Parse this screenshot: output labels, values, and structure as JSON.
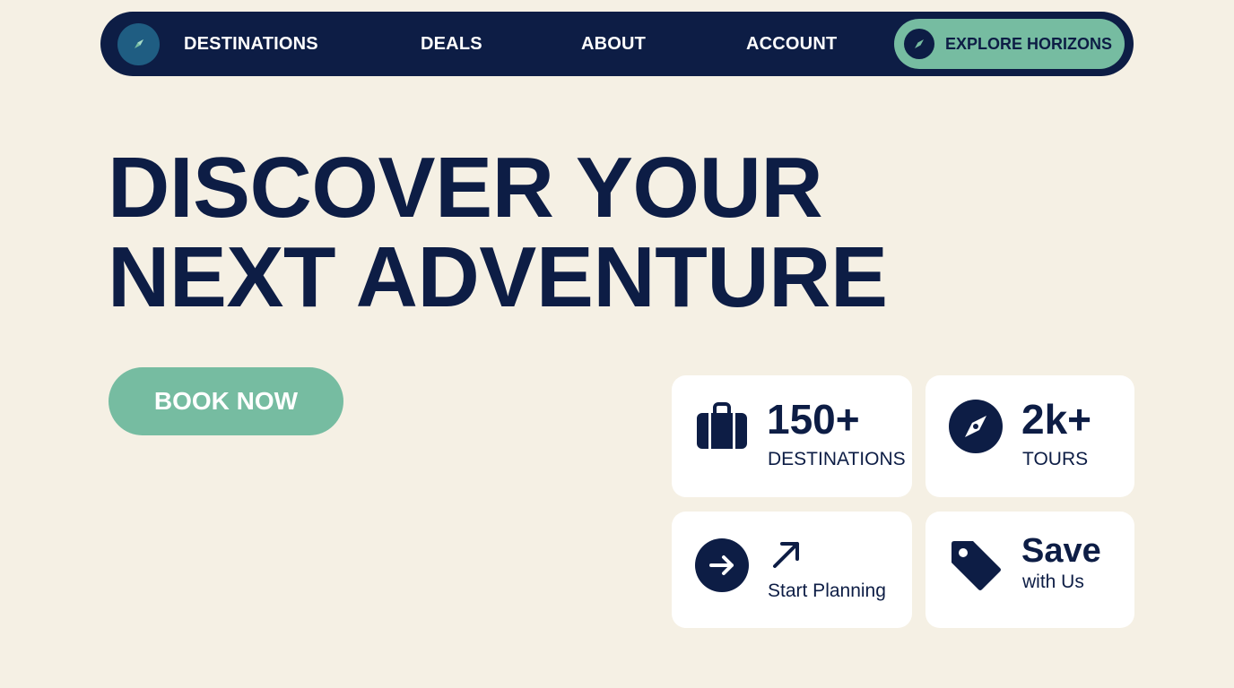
{
  "nav": {
    "items": [
      {
        "label": "DESTINATIONS"
      },
      {
        "label": "DEALS"
      },
      {
        "label": "ABOUT"
      },
      {
        "label": "ACCOUNT"
      }
    ],
    "cta_label": "EXPLORE HORIZONS",
    "logo_icon": "compass-icon",
    "cta_icon": "compass-icon"
  },
  "hero": {
    "title_line1": "DISCOVER YOUR",
    "title_line2": "NEXT ADVENTURE",
    "book_label": "BOOK NOW"
  },
  "cards": {
    "destinations": {
      "value": "150+",
      "label": "DESTINATIONS",
      "icon": "suitcase-icon"
    },
    "tours": {
      "value": "2k+",
      "label": "TOURS",
      "icon": "compass-icon"
    },
    "planning": {
      "label": "Start Planning",
      "icon": "arrow-right-icon",
      "accent_icon": "arrow-up-right-icon"
    },
    "save": {
      "title": "Save",
      "label": "with Us",
      "icon": "tag-icon"
    }
  },
  "colors": {
    "navy": "#0d1d45",
    "mint": "#76bca1",
    "background": "#f5f0e4",
    "card": "#ffffff"
  }
}
